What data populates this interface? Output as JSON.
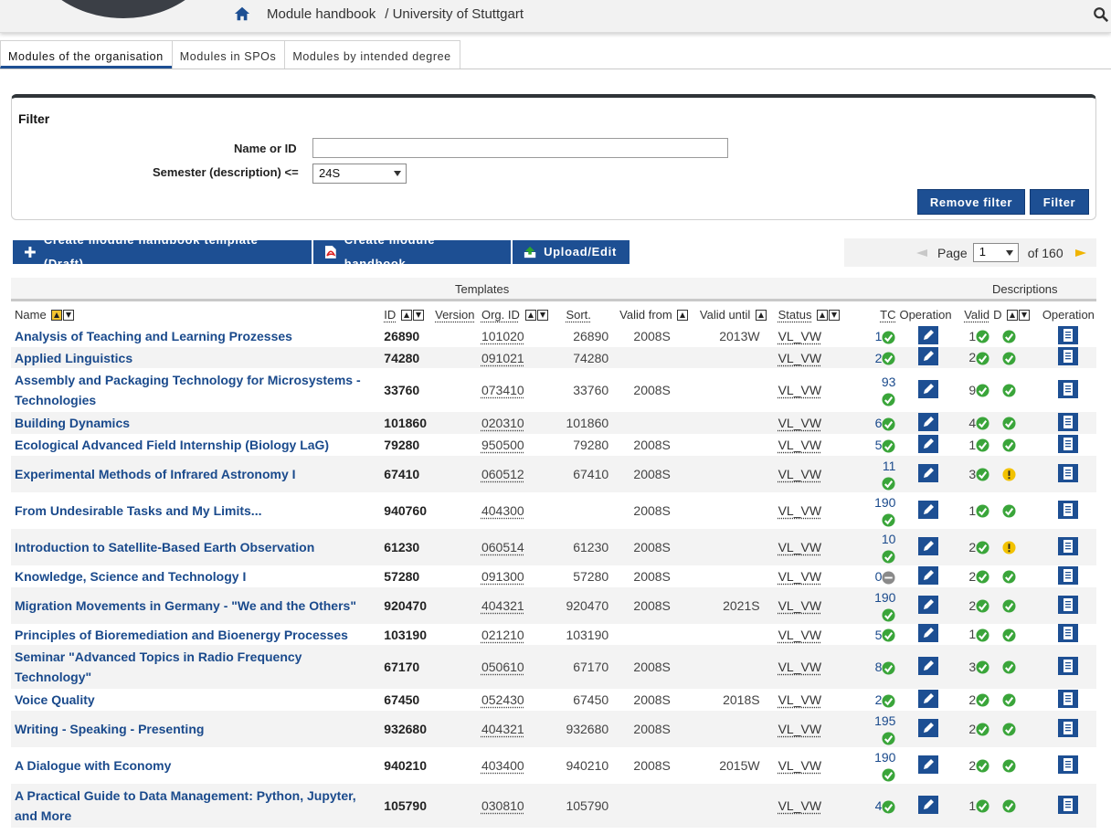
{
  "header": {
    "breadcrumb_title": "Module handbook",
    "breadcrumb_org": "/ University of Stuttgart"
  },
  "tabs": [
    {
      "label": "Modules of the organisation",
      "active": true
    },
    {
      "label": "Modules in SPOs",
      "active": false
    },
    {
      "label": "Modules by intended degree",
      "active": false
    }
  ],
  "filter": {
    "title": "Filter",
    "name_label": "Name or ID",
    "name_value": "",
    "semester_label": "Semester (description) <=",
    "semester_value": "24S",
    "remove_label": "Remove filter",
    "apply_label": "Filter"
  },
  "actions": {
    "create_template": "Create module handbook template (Draft)",
    "create_handbook": "Create module handbook",
    "upload": "Upload/Edit"
  },
  "pager": {
    "page_label": "Page",
    "page_value": "1",
    "of_label": "of 160"
  },
  "groups": {
    "templates": "Templates",
    "descriptions": "Descriptions"
  },
  "columns": {
    "name": "Name",
    "id": "ID",
    "version": "Version",
    "org_id": "Org. ID",
    "sort": "Sort.",
    "valid_from": "Valid from",
    "valid_until": "Valid until",
    "status": "Status",
    "tc": "TC",
    "operation": "Operation",
    "valid": "Valid",
    "d": "D",
    "operation2": "Operation"
  },
  "rows": [
    {
      "name": "Analysis of Teaching and Learning Prozesses",
      "id": "26890",
      "org": "101020",
      "sort": "26890",
      "from": "2008S",
      "until": "2013W",
      "status": "VL_VW",
      "tc": "1",
      "tc_icon": "ok",
      "valid": "1",
      "d": "ok"
    },
    {
      "name": "Applied Linguistics",
      "id": "74280",
      "org": "091021",
      "sort": "74280",
      "from": "",
      "until": "",
      "status": "VL_VW",
      "tc": "2",
      "tc_icon": "ok",
      "valid": "2",
      "d": "ok"
    },
    {
      "name": "Assembly and Packaging Technology for Microsystems - Technologies",
      "id": "33760",
      "org": "073410",
      "sort": "33760",
      "from": "2008S",
      "until": "",
      "status": "VL_VW",
      "tc": "93",
      "tc_icon": "ok",
      "valid": "9",
      "d": "ok"
    },
    {
      "name": "Building Dynamics",
      "id": "101860",
      "org": "020310",
      "sort": "101860",
      "from": "",
      "until": "",
      "status": "VL_VW",
      "tc": "6",
      "tc_icon": "ok",
      "valid": "4",
      "d": "ok"
    },
    {
      "name": "Ecological Advanced Field Internship (Biology LaG)",
      "id": "79280",
      "org": "950500",
      "sort": "79280",
      "from": "2008S",
      "until": "",
      "status": "VL_VW",
      "tc": "5",
      "tc_icon": "ok",
      "valid": "1",
      "d": "ok"
    },
    {
      "name": "Experimental Methods of Infrared Astronomy I",
      "id": "67410",
      "org": "060512",
      "sort": "67410",
      "from": "2008S",
      "until": "",
      "status": "VL_VW",
      "tc": "11",
      "tc_icon": "ok",
      "valid": "3",
      "d": "warn"
    },
    {
      "name": "From Undesirable Tasks and My Limits...",
      "id": "940760",
      "org": "404300",
      "sort": "",
      "from": "2008S",
      "until": "",
      "status": "VL_VW",
      "tc": "190",
      "tc_icon": "ok",
      "valid": "1",
      "d": "ok"
    },
    {
      "name": "Introduction to Satellite-Based Earth Observation",
      "id": "61230",
      "org": "060514",
      "sort": "61230",
      "from": "2008S",
      "until": "",
      "status": "VL_VW",
      "tc": "10",
      "tc_icon": "ok",
      "valid": "2",
      "d": "warn"
    },
    {
      "name": "Knowledge, Science and Technology I",
      "id": "57280",
      "org": "091300",
      "sort": "57280",
      "from": "2008S",
      "until": "",
      "status": "VL_VW",
      "tc": "0",
      "tc_icon": "none",
      "valid": "2",
      "d": "ok"
    },
    {
      "name": "Migration Movements in Germany - \"We and the Others\"",
      "id": "920470",
      "org": "404321",
      "sort": "920470",
      "from": "2008S",
      "until": "2021S",
      "status": "VL_VW",
      "tc": "190",
      "tc_icon": "ok",
      "valid": "2",
      "d": "ok"
    },
    {
      "name": "Principles of Bioremediation and Bioenergy Processes",
      "id": "103190",
      "org": "021210",
      "sort": "103190",
      "from": "",
      "until": "",
      "status": "VL_VW",
      "tc": "5",
      "tc_icon": "ok",
      "valid": "1",
      "d": "ok"
    },
    {
      "name": "Seminar \"Advanced Topics in Radio Frequency Technology\"",
      "id": "67170",
      "org": "050610",
      "sort": "67170",
      "from": "2008S",
      "until": "",
      "status": "VL_VW",
      "tc": "8",
      "tc_icon": "ok",
      "valid": "3",
      "d": "ok"
    },
    {
      "name": "Voice Quality",
      "id": "67450",
      "org": "052430",
      "sort": "67450",
      "from": "2008S",
      "until": "2018S",
      "status": "VL_VW",
      "tc": "2",
      "tc_icon": "ok",
      "valid": "2",
      "d": "ok"
    },
    {
      "name": "Writing - Speaking - Presenting",
      "id": "932680",
      "org": "404321",
      "sort": "932680",
      "from": "2008S",
      "until": "",
      "status": "VL_VW",
      "tc": "195",
      "tc_icon": "ok",
      "valid": "2",
      "d": "ok"
    },
    {
      "name": "A Dialogue with Economy",
      "id": "940210",
      "org": "403400",
      "sort": "940210",
      "from": "2008S",
      "until": "2015W",
      "status": "VL_VW",
      "tc": "190",
      "tc_icon": "ok",
      "valid": "2",
      "d": "ok"
    },
    {
      "name": "A Practical Guide to Data Management: Python, Jupyter, and More",
      "id": "105790",
      "org": "030810",
      "sort": "105790",
      "from": "",
      "until": "",
      "status": "VL_VW",
      "tc": "4",
      "tc_icon": "ok",
      "valid": "1",
      "d": "ok"
    }
  ],
  "icons": {
    "home": "home-icon",
    "search": "search-icon",
    "plus": "plus-icon",
    "pdf": "pdf-icon",
    "upload": "upload-icon",
    "prev": "prev-page-icon",
    "next": "next-page-icon",
    "check": "check-icon",
    "warn": "warning-icon",
    "none": "none-icon",
    "edit": "edit-icon",
    "doc": "document-icon"
  },
  "colors": {
    "accent": "#1d4f93",
    "link": "#1a4a8c",
    "ok": "#3aa53a",
    "warn": "#f2c200"
  }
}
